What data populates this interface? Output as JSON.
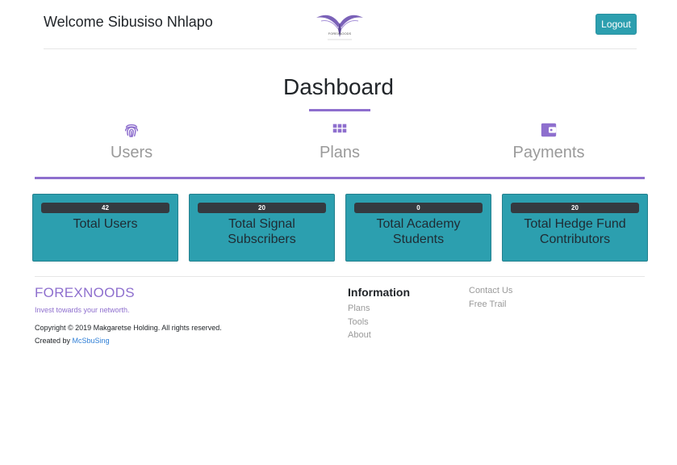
{
  "header": {
    "welcome": "Welcome Sibusiso Nhlapo",
    "logo_text": "FOREXNOODS",
    "logout_label": "Logout"
  },
  "page_title": "Dashboard",
  "nav": [
    {
      "label": "Users",
      "icon": "fingerprint-icon"
    },
    {
      "label": "Plans",
      "icon": "grid-icon"
    },
    {
      "label": "Payments",
      "icon": "wallet-icon"
    }
  ],
  "stats": [
    {
      "count": "42",
      "label": "Total Users"
    },
    {
      "count": "20",
      "label": "Total Signal Subscribers"
    },
    {
      "count": "0",
      "label": "Total Academy Students"
    },
    {
      "count": "20",
      "label": "Total Hedge Fund Contributors"
    }
  ],
  "footer": {
    "brand": "FOREXNOODS",
    "tagline": "Invest towards your networth.",
    "copyright": "Copyright © 2019 Makgaretse Holding. All rights reserved.",
    "created_by_prefix": "Created by",
    "created_by_link": "McSbuSing",
    "information_heading": "Information",
    "info_links": [
      "Plans",
      "Tools",
      "About"
    ],
    "extra_links": [
      "Contact Us",
      "Free Trail"
    ]
  },
  "colors": {
    "accent_purple": "#8e6fce",
    "card_teal": "#2c9faf",
    "badge_dark": "#343a40",
    "link_blue": "#2f7fd6"
  }
}
